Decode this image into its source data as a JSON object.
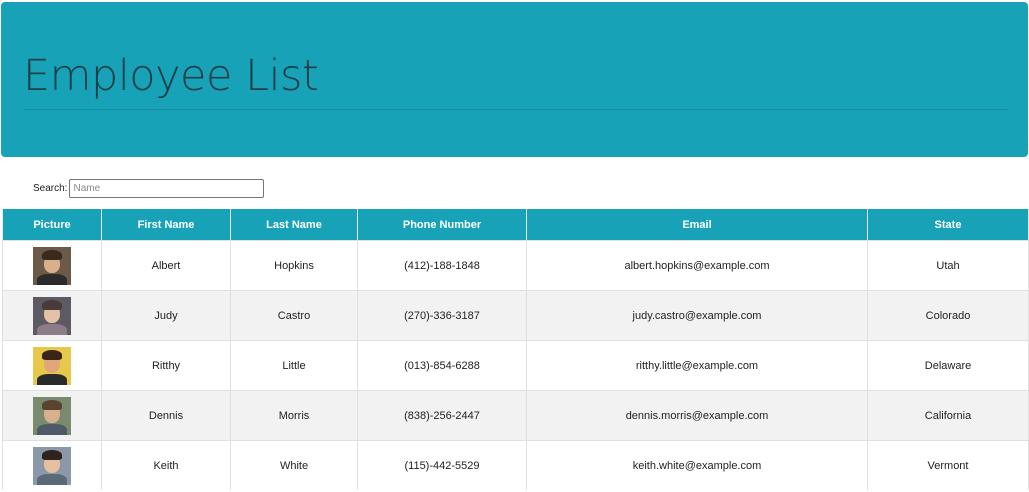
{
  "header": {
    "title": "Employee List"
  },
  "search": {
    "label": "Search:",
    "placeholder": "Name",
    "value": ""
  },
  "table": {
    "headers": [
      "Picture",
      "First Name",
      "Last Name",
      "Phone Number",
      "Email",
      "State"
    ],
    "rows": [
      {
        "first": "Albert",
        "last": "Hopkins",
        "phone": "(412)-188-1848",
        "email": "albert.hopkins@example.com",
        "state": "Utah"
      },
      {
        "first": "Judy",
        "last": "Castro",
        "phone": "(270)-336-3187",
        "email": "judy.castro@example.com",
        "state": "Colorado"
      },
      {
        "first": "Ritthy",
        "last": "Little",
        "phone": "(013)-854-6288",
        "email": "ritthy.little@example.com",
        "state": "Delaware"
      },
      {
        "first": "Dennis",
        "last": "Morris",
        "phone": "(838)-256-2447",
        "email": "dennis.morris@example.com",
        "state": "California"
      },
      {
        "first": "Keith",
        "last": "White",
        "phone": "(115)-442-5529",
        "email": "keith.white@example.com",
        "state": "Vermont"
      }
    ]
  },
  "colors": {
    "accent": "#17a2b8",
    "header_text": "#1b3f47",
    "row_stripe": "#f2f2f2"
  },
  "avatars": [
    {
      "bg": "#6b5a48",
      "skin": "#d9b08c",
      "hair": "#3a2a1e",
      "body": "#2b2b2b"
    },
    {
      "bg": "#5d5a64",
      "skin": "#e3c2a6",
      "hair": "#4a3a3a",
      "body": "#8c7c8a"
    },
    {
      "bg": "#e8c84a",
      "skin": "#e0a878",
      "hair": "#3b2418",
      "body": "#2a2a2a"
    },
    {
      "bg": "#7a8a6e",
      "skin": "#d8b090",
      "hair": "#5a4430",
      "body": "#4c5a6a"
    },
    {
      "bg": "#8a98a8",
      "skin": "#e6c0a0",
      "hair": "#2e241c",
      "body": "#5a6a78"
    }
  ]
}
